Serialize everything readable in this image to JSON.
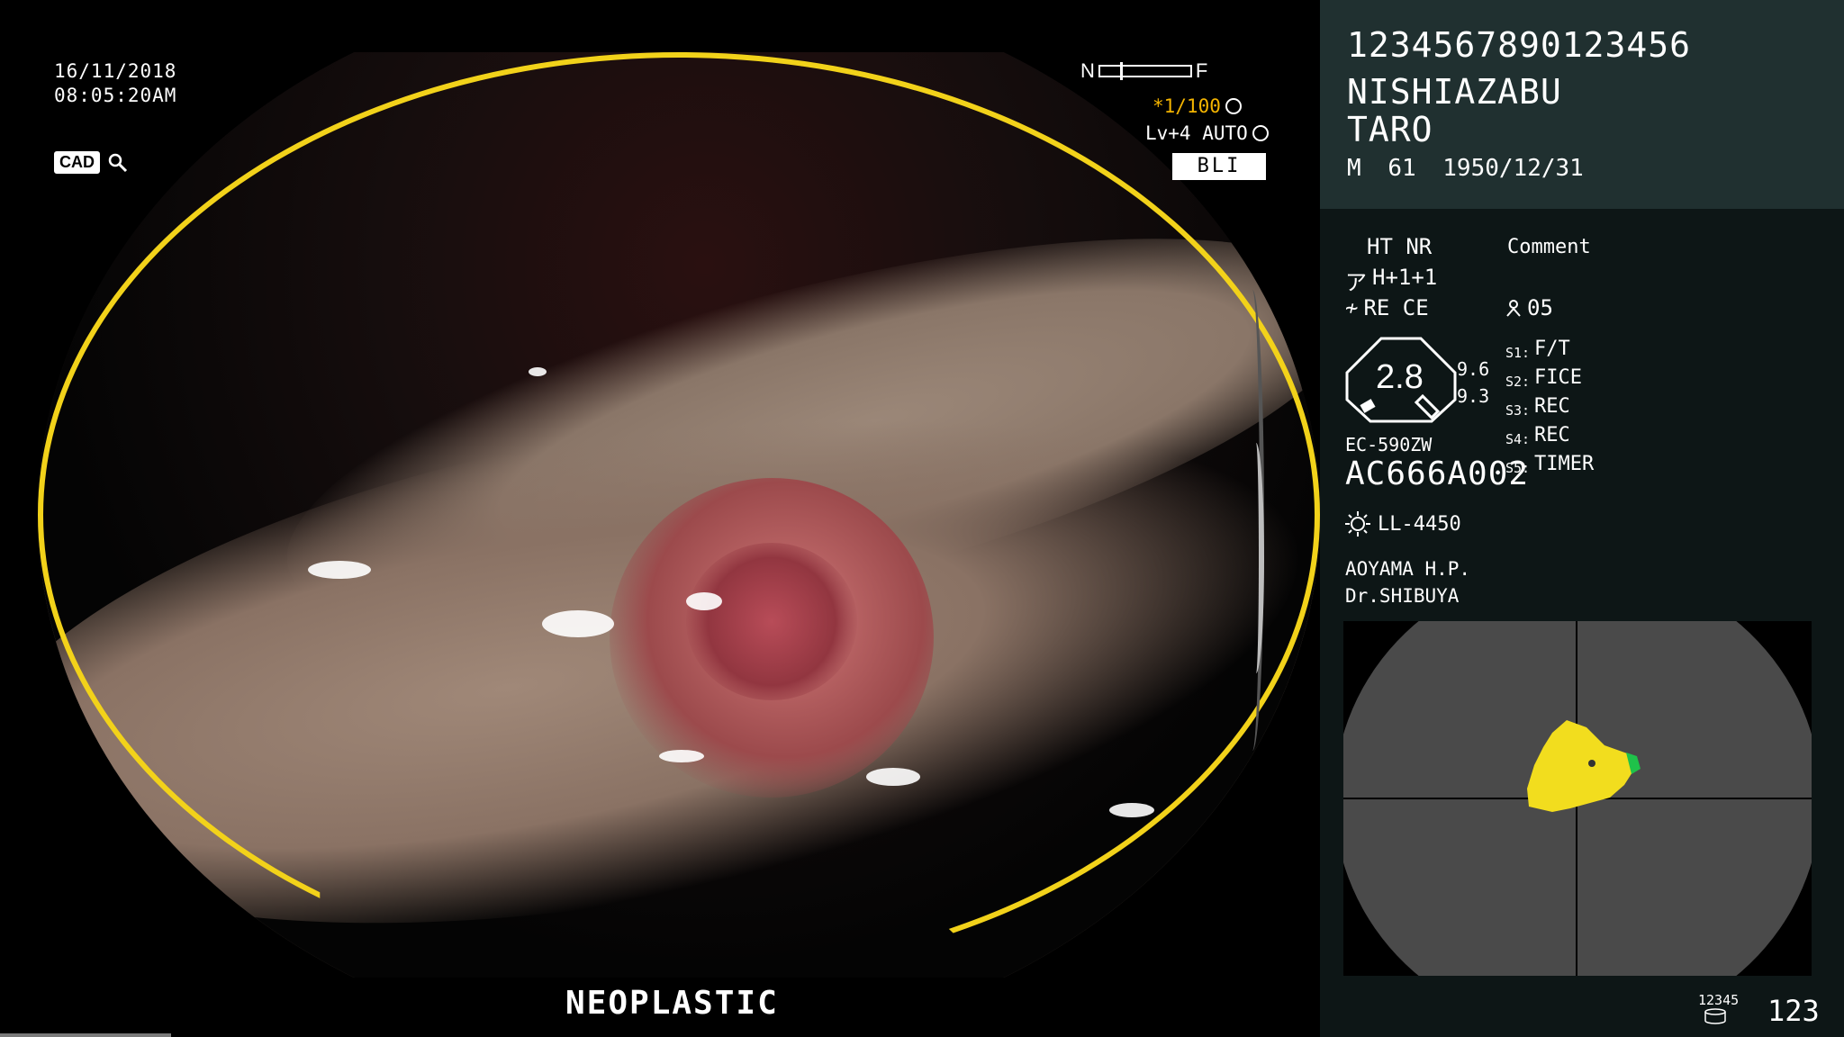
{
  "overlay": {
    "date": "16/11/2018",
    "time": "08:05:20AM",
    "cad_label": "CAD",
    "near_label": "N",
    "far_label": "F",
    "shutter": "*1/100",
    "level": "Lv+4 AUTO",
    "mode": "BLI",
    "classification": "NEOPLASTIC"
  },
  "patient": {
    "id": "1234567890123456",
    "name_last": "NISHIAZABU",
    "name_first": "TARO",
    "sex": "M",
    "age": "61",
    "dob": "1950/12/31"
  },
  "settings": {
    "ht_nr": "HT NR",
    "comment_label": "Comment",
    "h_value": "H+1+1",
    "re_ce": "RE CE",
    "count": "05",
    "gauge_value": "2.8",
    "gauge_a": "9.6",
    "gauge_b": "9.3",
    "scope_model": "EC-590ZW",
    "scope_serial": "AC666A002",
    "light_source": "LL-4450",
    "hospital": "AOYAMA H.P.",
    "doctor": "Dr.SHIBUYA"
  },
  "switches": [
    {
      "key": "S1:",
      "label": "F/T"
    },
    {
      "key": "S2:",
      "label": "FICE"
    },
    {
      "key": "S3:",
      "label": "REC"
    },
    {
      "key": "S4:",
      "label": "REC"
    },
    {
      "key": "S5:",
      "label": "TIMER"
    }
  ],
  "footer": {
    "storage_label": "12345",
    "frame_count": "123"
  },
  "colors": {
    "ring": "#f2d21a",
    "shutter": "#f4b400",
    "lesion_marker": "#f2dd1e",
    "lesion_marker_edge": "#1fc24a",
    "panel_top": "#203030",
    "panel": "#0d1616"
  },
  "icons": [
    "magnifier-icon",
    "aperture-icon",
    "auto-iris-icon",
    "hook-icon",
    "lightning-icon",
    "person-icon",
    "lens-gauge-icon",
    "sun-icon",
    "storage-icon"
  ]
}
